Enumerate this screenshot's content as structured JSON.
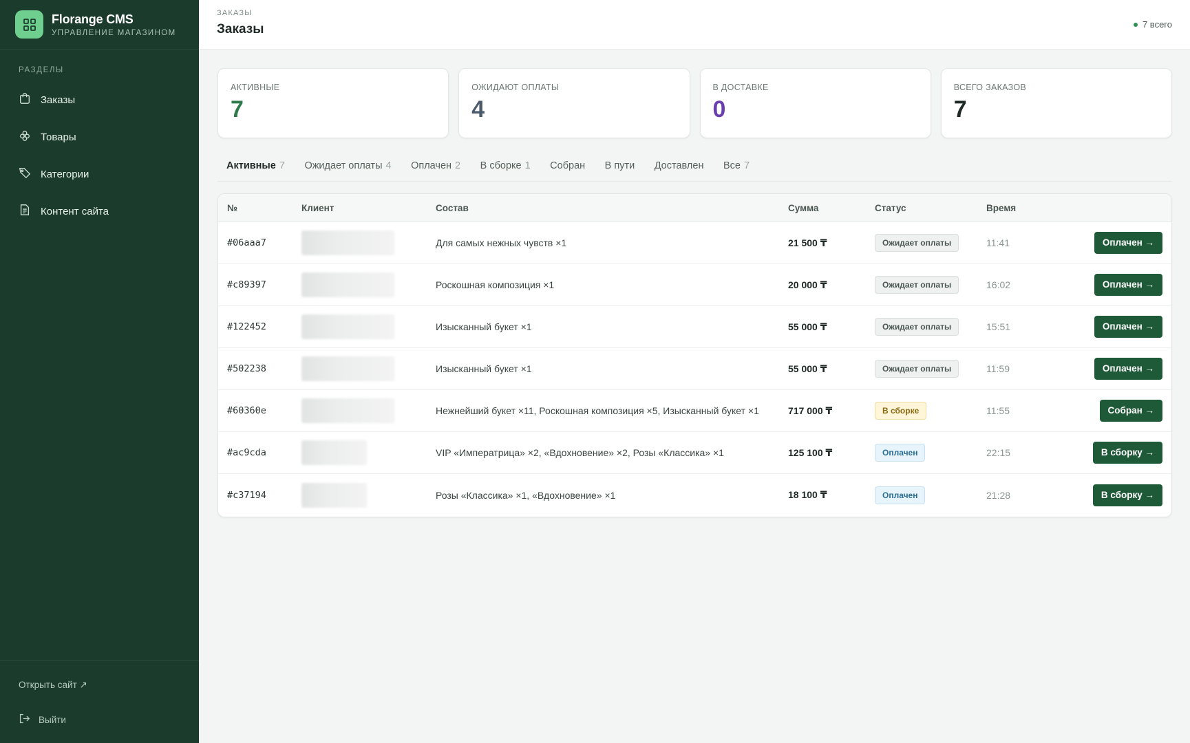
{
  "sidebar": {
    "brand_title": "Florange CMS",
    "brand_subtitle": "Управление магазином",
    "section_label": "Разделы",
    "items": [
      {
        "label": "Заказы",
        "icon": "bag-icon"
      },
      {
        "label": "Товары",
        "icon": "flower-icon"
      },
      {
        "label": "Категории",
        "icon": "tag-icon"
      },
      {
        "label": "Контент сайта",
        "icon": "document-icon"
      }
    ],
    "footer": {
      "open_site": "Открыть сайт ↗",
      "logout": "Выйти"
    }
  },
  "header": {
    "crumb": "Заказы",
    "title": "Заказы",
    "total": "7 всего"
  },
  "stats": [
    {
      "label": "Активные",
      "value": "7",
      "color": "#2f7a4a"
    },
    {
      "label": "Ожидают оплаты",
      "value": "4",
      "color": "#4a5a6a"
    },
    {
      "label": "В доставке",
      "value": "0",
      "color": "#6a3fb0"
    },
    {
      "label": "Всего заказов",
      "value": "7",
      "color": "#1f2a26"
    }
  ],
  "tabs": [
    {
      "label": "Активные",
      "count": "7",
      "active": true
    },
    {
      "label": "Ожидает оплаты",
      "count": "4"
    },
    {
      "label": "Оплачен",
      "count": "2"
    },
    {
      "label": "В сборке",
      "count": "1"
    },
    {
      "label": "Собран",
      "count": ""
    },
    {
      "label": "В пути",
      "count": ""
    },
    {
      "label": "Доставлен",
      "count": ""
    },
    {
      "label": "Все",
      "count": "7"
    }
  ],
  "table": {
    "headers": {
      "id": "№",
      "client": "Клиент",
      "items": "Состав",
      "sum": "Сумма",
      "status": "Статус",
      "time": "Время"
    },
    "rows": [
      {
        "id": "#06aaa7",
        "items": "Для самых нежных чувств ×1",
        "sum": "21 500 ₸",
        "status": "Ожидает оплаты",
        "status_kind": "wait",
        "time": "11:41",
        "action": "Оплачен →"
      },
      {
        "id": "#c89397",
        "items": "Роскошная композиция ×1",
        "sum": "20 000 ₸",
        "status": "Ожидает оплаты",
        "status_kind": "wait",
        "time": "16:02",
        "action": "Оплачен →"
      },
      {
        "id": "#122452",
        "items": "Изысканный букет ×1",
        "sum": "55 000 ₸",
        "status": "Ожидает оплаты",
        "status_kind": "wait",
        "time": "15:51",
        "action": "Оплачен →"
      },
      {
        "id": "#502238",
        "items": "Изысканный букет ×1",
        "sum": "55 000 ₸",
        "status": "Ожидает оплаты",
        "status_kind": "wait",
        "time": "11:59",
        "action": "Оплачен →"
      },
      {
        "id": "#60360e",
        "items": "Нежнейший букет ×11, Роскошная композиция ×5, Изысканный букет ×1",
        "sum": "717 000 ₸",
        "status": "В сборке",
        "status_kind": "build",
        "time": "11:55",
        "action": "Собран →"
      },
      {
        "id": "#ac9cda",
        "items": "VIP «Императрица» ×2, «Вдохновение» ×2, Розы «Классика» ×1",
        "sum": "125 100 ₸",
        "status": "Оплачен",
        "status_kind": "paid",
        "time": "22:15",
        "action": "В сборку →"
      },
      {
        "id": "#c37194",
        "items": "Розы «Классика» ×1, «Вдохновение» ×1",
        "sum": "18 100 ₸",
        "status": "Оплачен",
        "status_kind": "paid",
        "time": "21:28",
        "action": "В сборку →"
      }
    ]
  },
  "colors": {
    "sidebar_bg": "#1b3b2c",
    "brand_logo": "#6fcf8f",
    "primary_button": "#1e5a37"
  }
}
